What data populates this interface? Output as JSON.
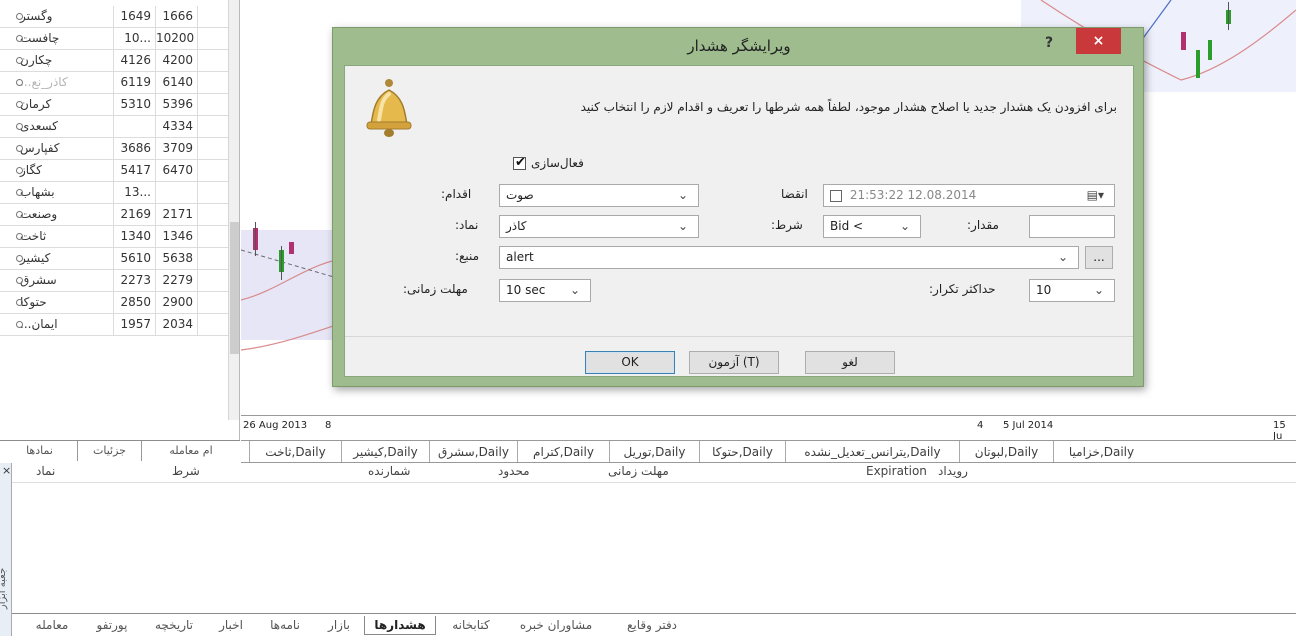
{
  "market_watch": {
    "rows": [
      {
        "symbol": "وگستر",
        "bid": "1649",
        "ask": "1666",
        "grey": false
      },
      {
        "symbol": "چافست",
        "bid": "10...",
        "ask": "10200",
        "grey": false
      },
      {
        "symbol": "چکارن",
        "bid": "4126",
        "ask": "4200",
        "grey": false
      },
      {
        "symbol": "کاذر_نع...",
        "bid": "6119",
        "ask": "6140",
        "grey": true
      },
      {
        "symbol": "کرمان",
        "bid": "5310",
        "ask": "5396",
        "grey": false
      },
      {
        "symbol": "کسعدی",
        "bid": "",
        "ask": "4334",
        "grey": false
      },
      {
        "symbol": "کفپارس",
        "bid": "3686",
        "ask": "3709",
        "grey": false
      },
      {
        "symbol": "کگاز",
        "bid": "5417",
        "ask": "6470",
        "grey": false
      },
      {
        "symbol": "بشهاب",
        "bid": "13...",
        "ask": "",
        "grey": false
      },
      {
        "symbol": "وصنعت",
        "bid": "2169",
        "ask": "2171",
        "grey": false
      },
      {
        "symbol": "ثاخت",
        "bid": "1340",
        "ask": "1346",
        "grey": false
      },
      {
        "symbol": "کیشیر",
        "bid": "5610",
        "ask": "5638",
        "grey": false
      },
      {
        "symbol": "سشرق",
        "bid": "2273",
        "ask": "2279",
        "grey": false
      },
      {
        "symbol": "حتوکا",
        "bid": "2850",
        "ask": "2900",
        "grey": false
      },
      {
        "symbol": "ایمان...",
        "bid": "1957",
        "ask": "2034",
        "grey": false
      }
    ],
    "tabs": [
      "نمادها",
      "جزئیات",
      "ام معامله"
    ]
  },
  "chart": {
    "axis_labels": [
      "26 Aug 2013",
      "8",
      "4",
      "5 Jul 2014",
      "15 Ju"
    ],
    "tabs": [
      "ثاخت,Daily",
      "کیشیر,Daily",
      "سشرق,Daily",
      "کترام,Daily",
      "توریل,Daily",
      "حتوکا,Daily",
      "یترانس_تعدیل_نشده,Daily",
      "لبوتان,Daily",
      "خزامیا,Daily"
    ],
    "colors": {
      "bull": "#2a9d2a",
      "bear": "#b03070",
      "band": "#d98a8a",
      "shade": "#e6e6f7"
    }
  },
  "dialog": {
    "title": "ویرایشگر هشدار",
    "help": "?",
    "close": "×",
    "instruction": "برای افزودن یک هشدار جدید یا اصلاح هشدار موجود، لطفاً همه شرطها را تعریف و اقدام لازم را انتخاب کنید",
    "enable_label": "فعال‌سازی",
    "enabled": true,
    "action_label": ":اقدام",
    "action_value": "صوت",
    "expiry_label": "انقضا",
    "expiry_value": "21:53:22 12.08.2014",
    "symbol_label": ":نماد",
    "symbol_value": "کاذر",
    "condition_label": ":شرط",
    "condition_value": "Bid <",
    "amount_label": ":مقدار",
    "amount_value": "",
    "source_label": ":منبع",
    "source_value": "alert",
    "browse": "...",
    "timeout_label": ":مهلت زمانی",
    "timeout_value": "10 sec",
    "max_repeat_label": ":حداکثر تکرار",
    "max_repeat_value": "10",
    "buttons": {
      "ok": "OK",
      "test": "آزمون (T)",
      "cancel": "لغو"
    }
  },
  "terminal": {
    "close": "×",
    "side_label": "جعبه ابزار",
    "columns": [
      "نماد",
      "شرط",
      "شمارنده",
      "محدود",
      "مهلت زمانی",
      "Expiration",
      "رویداد"
    ],
    "tabs": [
      "معامله",
      "پورتفو",
      "تاریخچه",
      "اخبار",
      "نامه‌ها",
      "بازار",
      "هشدارها",
      "کتابخانه",
      "مشاوران خبره",
      "دفتر وقایع"
    ],
    "active_tab": "هشدارها"
  }
}
